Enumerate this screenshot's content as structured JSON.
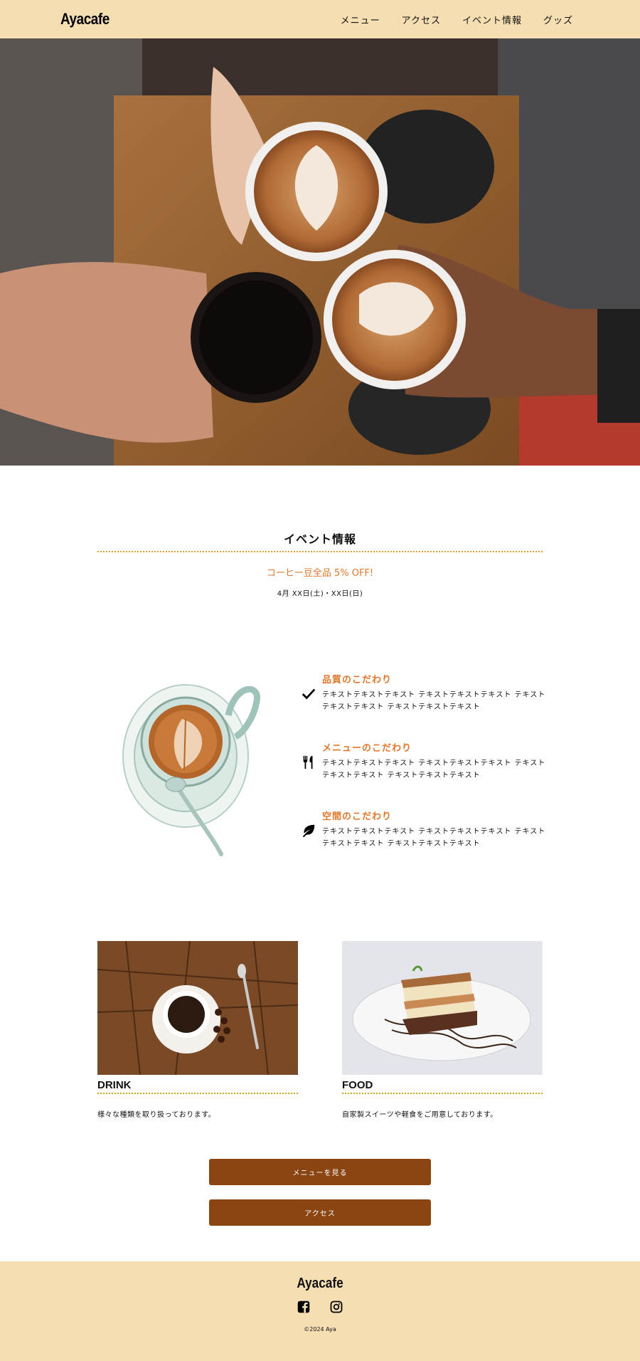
{
  "header": {
    "logo": "Ayacafe",
    "nav": [
      "メニュー",
      "アクセス",
      "イベント情報",
      "グッズ"
    ]
  },
  "event": {
    "title": "イベント情報",
    "sale": "コーヒー豆全品 5% OFF!",
    "date": "4月 XX日(土)・XX日(日)"
  },
  "features": [
    {
      "icon": "checkmark-icon",
      "title": "品質のこだわり",
      "text": "テキストテキストテキスト テキストテキストテキスト テキストテキストテキスト テキストテキストテキスト"
    },
    {
      "icon": "utensils-icon",
      "title": "メニューのこだわり",
      "text": "テキストテキストテキスト テキストテキストテキスト テキストテキストテキスト テキストテキストテキスト"
    },
    {
      "icon": "leaf-icon",
      "title": "空間のこだわり",
      "text": "テキストテキストテキスト テキストテキストテキスト テキストテキストテキスト テキストテキストテキスト"
    }
  ],
  "cards": [
    {
      "title": "DRINK",
      "text": "様々な種類を取り扱っております。"
    },
    {
      "title": "FOOD",
      "text": "自家製スイーツや軽食をご用意しております。"
    }
  ],
  "buttons": {
    "menu": "メニューを見る",
    "access": "アクセス"
  },
  "footer": {
    "logo": "Ayacafe",
    "social": [
      "facebook-icon",
      "instagram-icon"
    ],
    "copyright": "©2024 Aya"
  },
  "colors": {
    "header_bg": "#f6deb3",
    "accent": "#e0762a",
    "button": "#8b4513",
    "divider": "#d9a12a"
  }
}
